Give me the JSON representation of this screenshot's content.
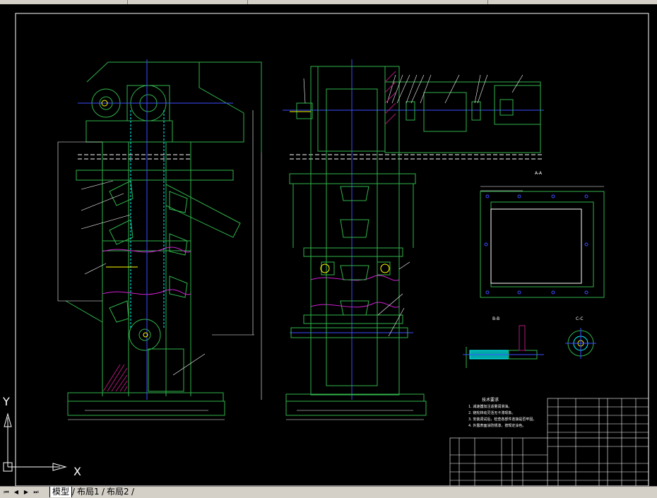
{
  "window": {
    "title": ""
  },
  "layout_tabs": {
    "nav_first": "⏮",
    "nav_prev": "◀",
    "nav_next": "▶",
    "nav_last": "⏭",
    "tabs": [
      {
        "label": "模型",
        "active": true
      },
      {
        "label": "布局1",
        "active": false
      },
      {
        "label": "布局2",
        "active": false
      }
    ]
  },
  "drawing": {
    "section_labels": {
      "a": "A-A",
      "b": "B-B",
      "c": "C-C"
    },
    "tech_notes": {
      "title": "技术要求",
      "lines": [
        "1. 减速器加注适量润滑油。",
        "2. 链轮转动灵活无卡滞现象。",
        "3. 安装调试后，检查各部件连接是否牢固。",
        "4. 外露表面涂防锈漆，按规定涂色。"
      ]
    },
    "ucs": {
      "x": "X",
      "y": "Y"
    },
    "colors": {
      "frame": "#ffffff",
      "outline": "#2fb34a",
      "centerline": "#3b4dff",
      "chain": "#00ffff",
      "dimension": "#ffffff",
      "hatch": "#b0187a",
      "magenta": "#d020d0",
      "yellow": "#ffff00"
    }
  }
}
